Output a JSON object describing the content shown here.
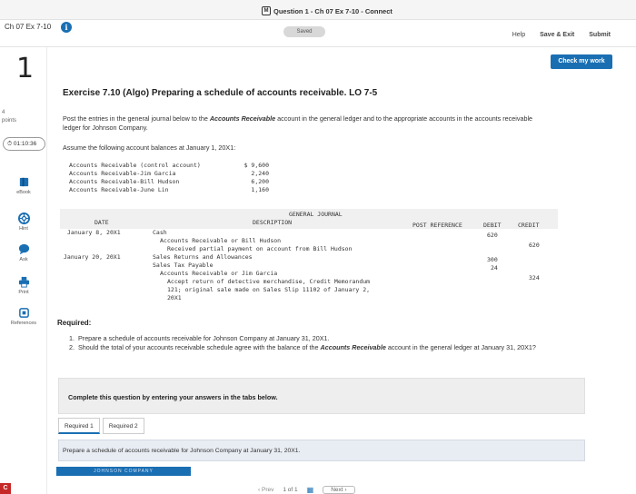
{
  "window": {
    "title": "Question 1 - Ch 07 Ex 7-10 - Connect",
    "app_badge": "M"
  },
  "header": {
    "assignment": "Ch 07 Ex 7-10",
    "saved": "Saved",
    "help": "Help",
    "save_exit": "Save & Exit",
    "submit": "Submit"
  },
  "sidebar": {
    "question_number": "1",
    "points_value": "4",
    "points_label": "points",
    "timer": "01:10:36",
    "tools": [
      {
        "label": "eBook",
        "icon": "book-icon"
      },
      {
        "label": "Hint",
        "icon": "lifebuoy-icon"
      },
      {
        "label": "Ask",
        "icon": "chat-icon"
      },
      {
        "label": "Print",
        "icon": "printer-icon"
      },
      {
        "label": "References",
        "icon": "references-icon"
      }
    ]
  },
  "main": {
    "check_button": "Check my work",
    "exercise_title": "Exercise 7.10 (Algo) Preparing a schedule of accounts receivable. LO 7-5",
    "instructions_before": "Post the entries in the general journal below to the ",
    "instructions_bold": "Accounts Receivable",
    "instructions_after": " account in the general ledger and to the appropriate accounts in the accounts receivable ledger for Johnson Company.",
    "assume": "Assume the following account balances at January 1, 20X1:",
    "balances": [
      {
        "label": "Accounts Receivable (control account)",
        "value": "$ 9,600"
      },
      {
        "label": "Accounts Receivable-Jim Garcia",
        "value": "2,240"
      },
      {
        "label": "Accounts Receivable-Bill Hudson",
        "value": "6,200"
      },
      {
        "label": "Accounts Receivable-June Lin",
        "value": "1,160"
      }
    ],
    "journal": {
      "title": "GENERAL JOURNAL",
      "columns": {
        "date": "DATE",
        "description": "DESCRIPTION",
        "post_ref": "POST REFERENCE",
        "debit": "DEBIT",
        "credit": "CREDIT"
      },
      "date1": "January 8, 20X1",
      "date2": "January 20, 20X1",
      "lines": [
        "Cash",
        "Accounts Receivable or Bill Hudson",
        "Received partial payment on account from Bill Hudson",
        "Sales Returns and Allowances",
        "Sales Tax Payable",
        "Accounts Receivable or Jim Garcia",
        "Accept return of detective merchandise, Credit Memorandum",
        "121; original sale made on Sales Slip 11102 of January 2,",
        "20X1"
      ],
      "amounts": {
        "d1": "620",
        "c1": "620",
        "d2": "300",
        "d3": "24",
        "c2": "324"
      }
    },
    "required_heading": "Required:",
    "required": [
      {
        "n": "1.",
        "text": "Prepare a schedule of accounts receivable for Johnson Company at January 31, 20X1."
      },
      {
        "n": "2.",
        "before": "Should the total of your accounts receivable schedule agree with the balance of the ",
        "bold": "Accounts Receivable",
        "after": " account in the general ledger at January 31, 20X1?"
      }
    ],
    "complete_note": "Complete this question by entering your answers in the tabs below.",
    "tabs": [
      "Required 1",
      "Required 2"
    ],
    "prepare_text": "Prepare a schedule of accounts receivable for Johnson Company at January 31, 20X1.",
    "company_header": "JOHNSON COMPANY"
  },
  "pager": {
    "prev": "Prev",
    "current": "1",
    "of": "of",
    "total": "1",
    "next": "Next"
  },
  "corner": "C",
  "colors": {
    "accent": "#1a6fb3",
    "corner": "#c62828"
  }
}
